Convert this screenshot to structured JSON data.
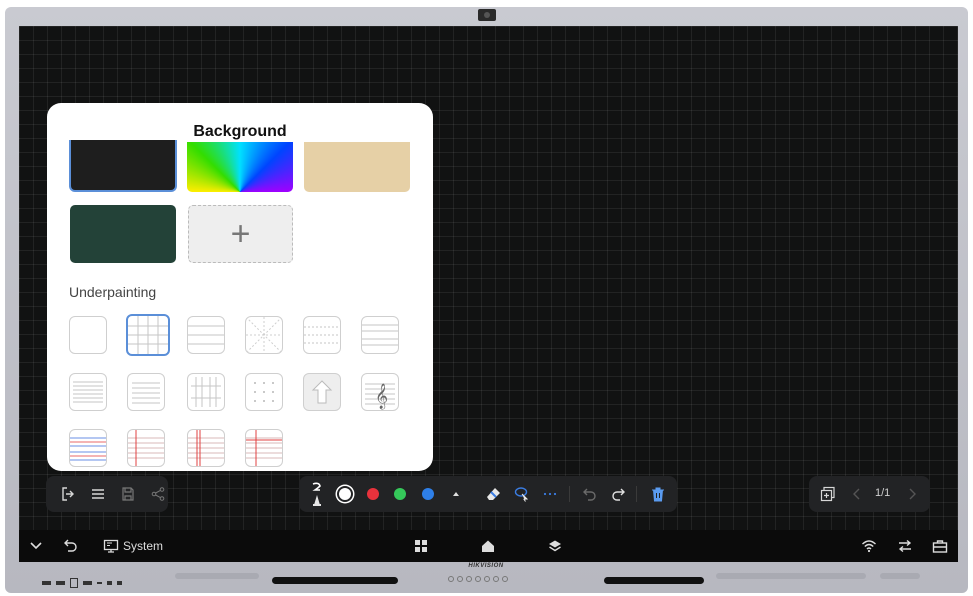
{
  "panel": {
    "title": "Background",
    "add_symbol": "+",
    "underpainting_label": "Underpainting",
    "selected_background": "black",
    "selected_underpainting": "grid"
  },
  "backgrounds": [
    {
      "name": "black",
      "color": "#1e1e1e"
    },
    {
      "name": "rainbow",
      "color": "gradient"
    },
    {
      "name": "beige",
      "color": "#e6d0a6"
    },
    {
      "name": "green",
      "color": "#234238"
    }
  ],
  "colors": {
    "red": "#e8323c",
    "green": "#35c85a",
    "blue": "#2e7fe8",
    "white": "#ffffff",
    "accent": "#5b8fd8"
  },
  "toolbar_left": [
    "exit-icon",
    "menu-icon",
    "save-icon",
    "share-icon"
  ],
  "toolbar_mid": [
    "pen-icon",
    "color-white",
    "color-red",
    "color-green",
    "color-blue",
    "chevron-up-icon",
    "eraser-icon",
    "lasso-icon",
    "more-icon",
    "undo-icon",
    "redo-icon",
    "delete-icon"
  ],
  "pager": {
    "label": "1/1"
  },
  "taskbar": {
    "system_label": "System"
  },
  "brand": {
    "name": "HIKVISION"
  }
}
